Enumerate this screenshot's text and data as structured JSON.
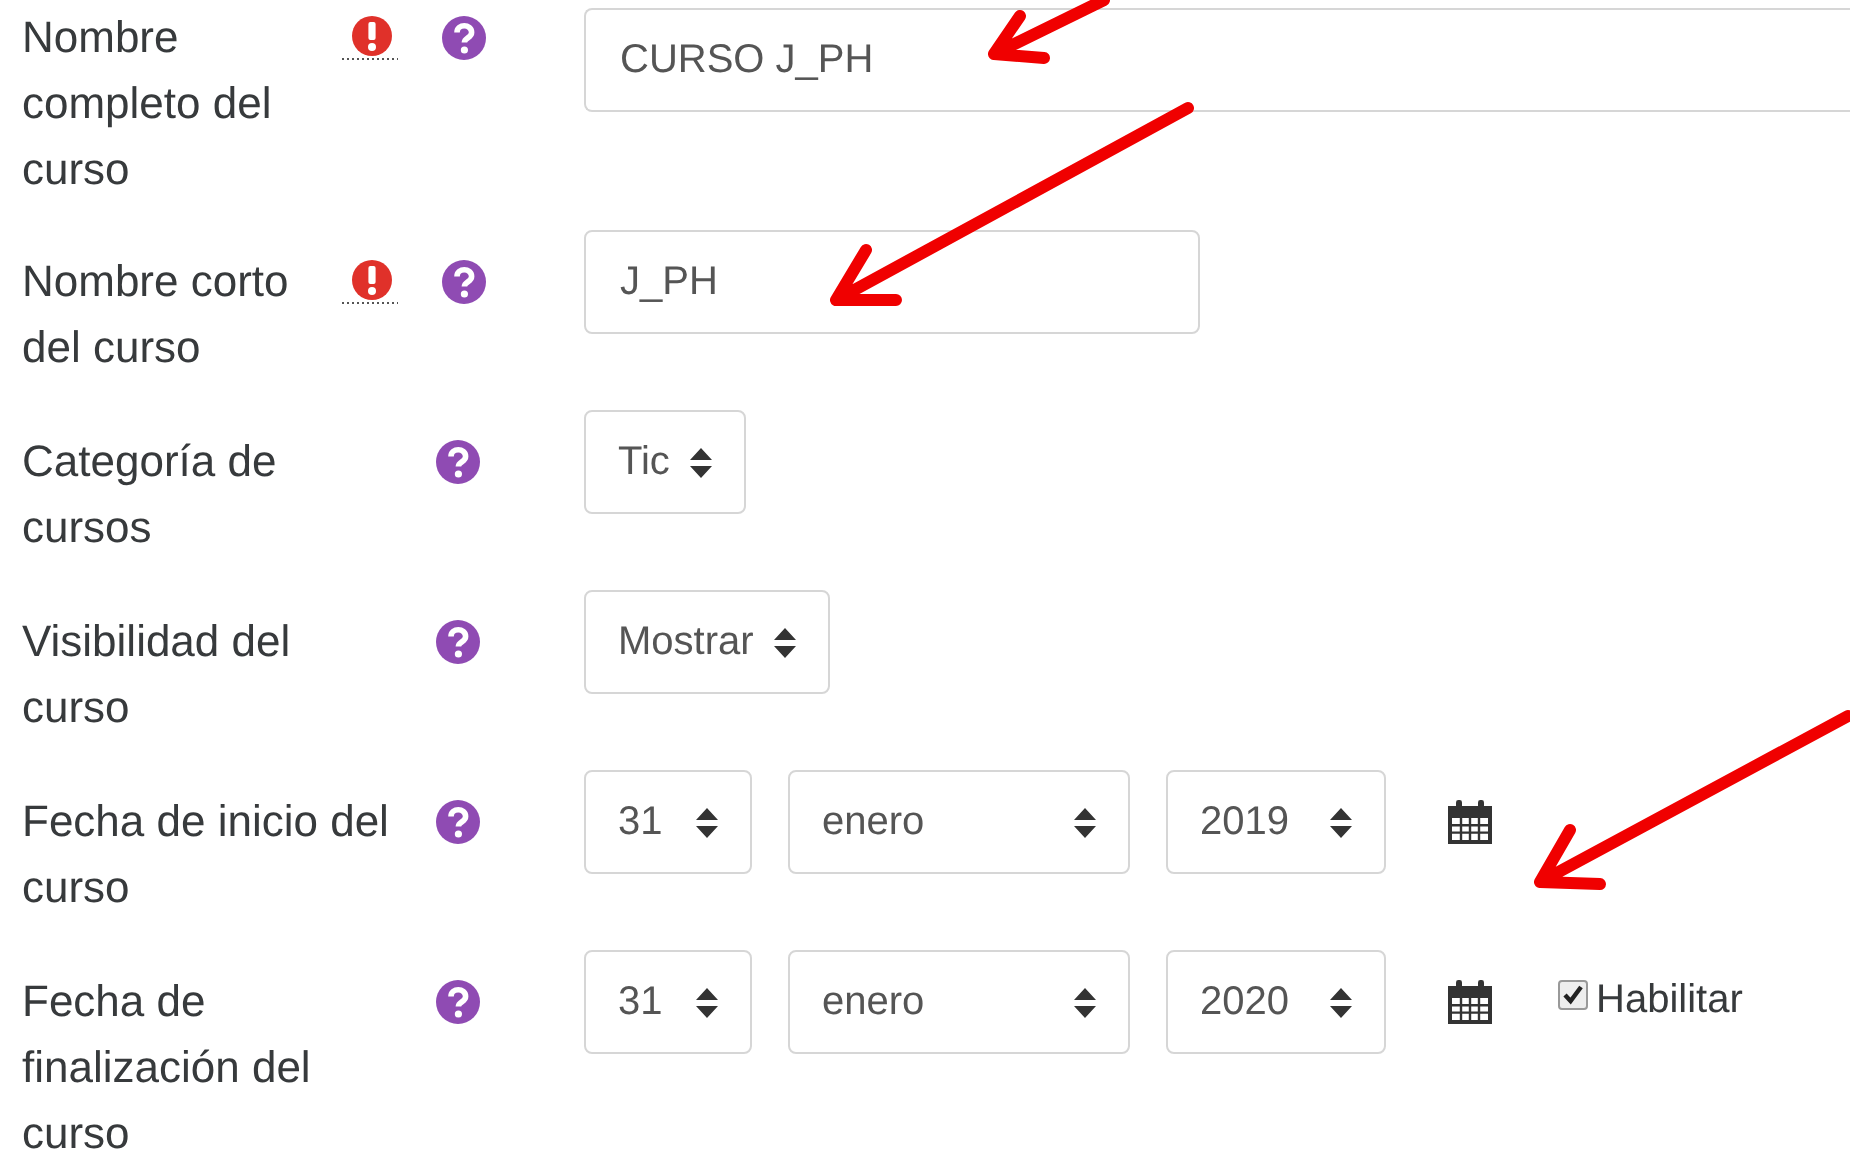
{
  "fields": [
    {
      "kind": "text",
      "label": "Nombre completo del curso",
      "required": true,
      "value": "CURSO J_PH",
      "wide": true
    },
    {
      "kind": "text",
      "label": "Nombre corto del curso",
      "required": true,
      "value": "J_PH",
      "wide": false
    },
    {
      "kind": "select",
      "label": "Categoría de cursos",
      "required": false,
      "value": "Tic"
    },
    {
      "kind": "select",
      "label": "Visibilidad del curso",
      "required": false,
      "value": "Mostrar"
    },
    {
      "kind": "date",
      "label": "Fecha de inicio del curso",
      "required": false,
      "day": "31",
      "month": "enero",
      "year": "2019"
    },
    {
      "kind": "date",
      "label": "Fecha de finalización del curso",
      "required": false,
      "day": "31",
      "month": "enero",
      "year": "2020",
      "enable": {
        "label": "Habilitar",
        "checked": true
      }
    }
  ]
}
